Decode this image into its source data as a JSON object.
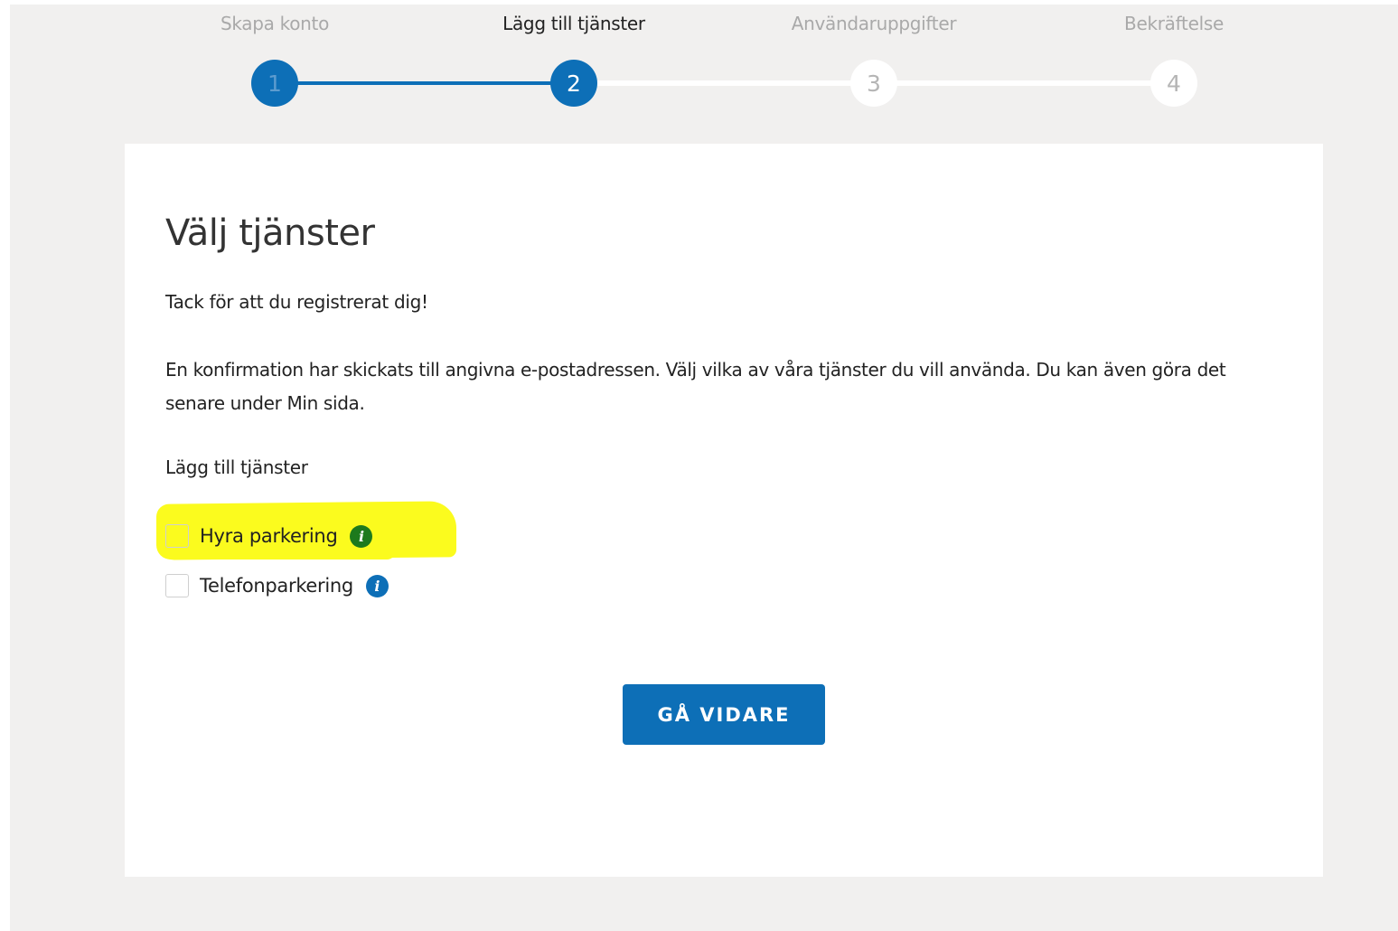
{
  "stepper": {
    "steps": [
      {
        "label": "Skapa konto",
        "number": "1",
        "state": "done"
      },
      {
        "label": "Lägg till tjänster",
        "number": "2",
        "state": "current"
      },
      {
        "label": "Användaruppgifter",
        "number": "3",
        "state": "upcoming"
      },
      {
        "label": "Bekräftelse",
        "number": "4",
        "state": "upcoming"
      }
    ]
  },
  "card": {
    "title": "Välj tjänster",
    "thanks": "Tack för att du registrerat dig!",
    "confirmation": "En konfirmation har skickats till angivna e-postadressen. Välj vilka av våra tjänster du vill använda. Du kan även göra det senare under Min sida.",
    "services_heading": "Lägg till tjänster",
    "services": [
      {
        "label": "Hyra parkering",
        "checked": false,
        "info_icon": "info-icon",
        "info_color": "#1d7a1d"
      },
      {
        "label": "Telefonparkering",
        "checked": false,
        "info_icon": "info-icon",
        "info_color": "#0d6fb7"
      }
    ],
    "continue_label": "GÅ VIDARE"
  },
  "colors": {
    "accent": "#0d6fb7",
    "background": "#f1f0ef",
    "highlight": "#fbfb1e"
  }
}
